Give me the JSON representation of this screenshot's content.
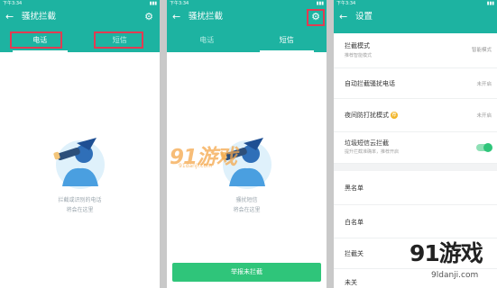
{
  "status_time": "下午3:34",
  "colors": {
    "primary": "#1db3a1",
    "button_green": "#2fc57a",
    "highlight_red": "#e23b52"
  },
  "screen1": {
    "title": "骚扰拦截",
    "tabs": [
      {
        "label": "电话"
      },
      {
        "label": "短信"
      }
    ],
    "empty_line1": "拦截或识别的电话",
    "empty_line2": "将会在这里"
  },
  "screen2": {
    "title": "骚扰拦截",
    "tabs": [
      {
        "label": "电话"
      },
      {
        "label": "短信"
      }
    ],
    "empty_line1": "骚扰短信",
    "empty_line2": "将会在这里",
    "report_button": "举报未拦截"
  },
  "screen3": {
    "title": "设置",
    "items": [
      {
        "label": "拦截模式",
        "sub": "推荐智能模式",
        "value": "智能模式"
      },
      {
        "label": "自动拦截骚扰电话",
        "value": "未开启"
      },
      {
        "label": "夜间防打扰模式",
        "badge": "荐",
        "value": "未开启"
      },
      {
        "label": "垃圾短信云拦截",
        "sub": "提升拦截准确率，推荐开启",
        "toggle": true
      },
      {
        "label": "黑名单"
      },
      {
        "label": "白名单"
      },
      {
        "label": "拦截关"
      },
      {
        "label": "未关"
      }
    ]
  },
  "watermarks": {
    "center": "91游戏",
    "center_sub": "91danji.com",
    "corner": "91游戏",
    "corner_sub": "9ldanji.com"
  }
}
